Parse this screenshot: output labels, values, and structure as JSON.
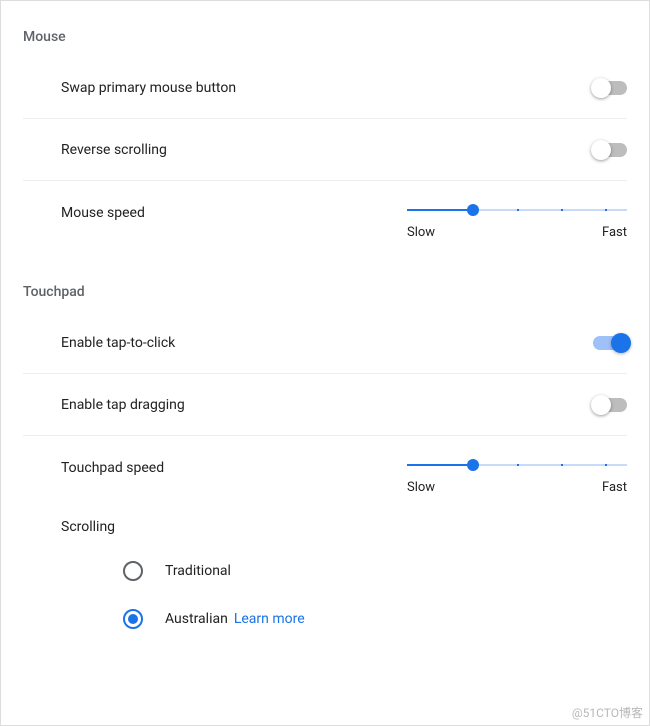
{
  "mouse": {
    "section_title": "Mouse",
    "swap_label": "Swap primary mouse button",
    "swap_enabled": false,
    "reverse_label": "Reverse scrolling",
    "reverse_enabled": false,
    "speed_label": "Mouse speed",
    "speed_value": 30,
    "speed_slow": "Slow",
    "speed_fast": "Fast"
  },
  "touchpad": {
    "section_title": "Touchpad",
    "tap_click_label": "Enable tap-to-click",
    "tap_click_enabled": true,
    "tap_drag_label": "Enable tap dragging",
    "tap_drag_enabled": false,
    "speed_label": "Touchpad speed",
    "speed_value": 30,
    "speed_slow": "Slow",
    "speed_fast": "Fast",
    "scrolling_label": "Scrolling",
    "scroll_options": {
      "traditional": "Traditional",
      "australian": "Australian",
      "selected": "australian",
      "learn_more": "Learn more"
    }
  },
  "watermark": "@51CTO博客",
  "colors": {
    "accent": "#1a73e8",
    "muted_text": "#5f6368",
    "divider": "#eceeef"
  }
}
